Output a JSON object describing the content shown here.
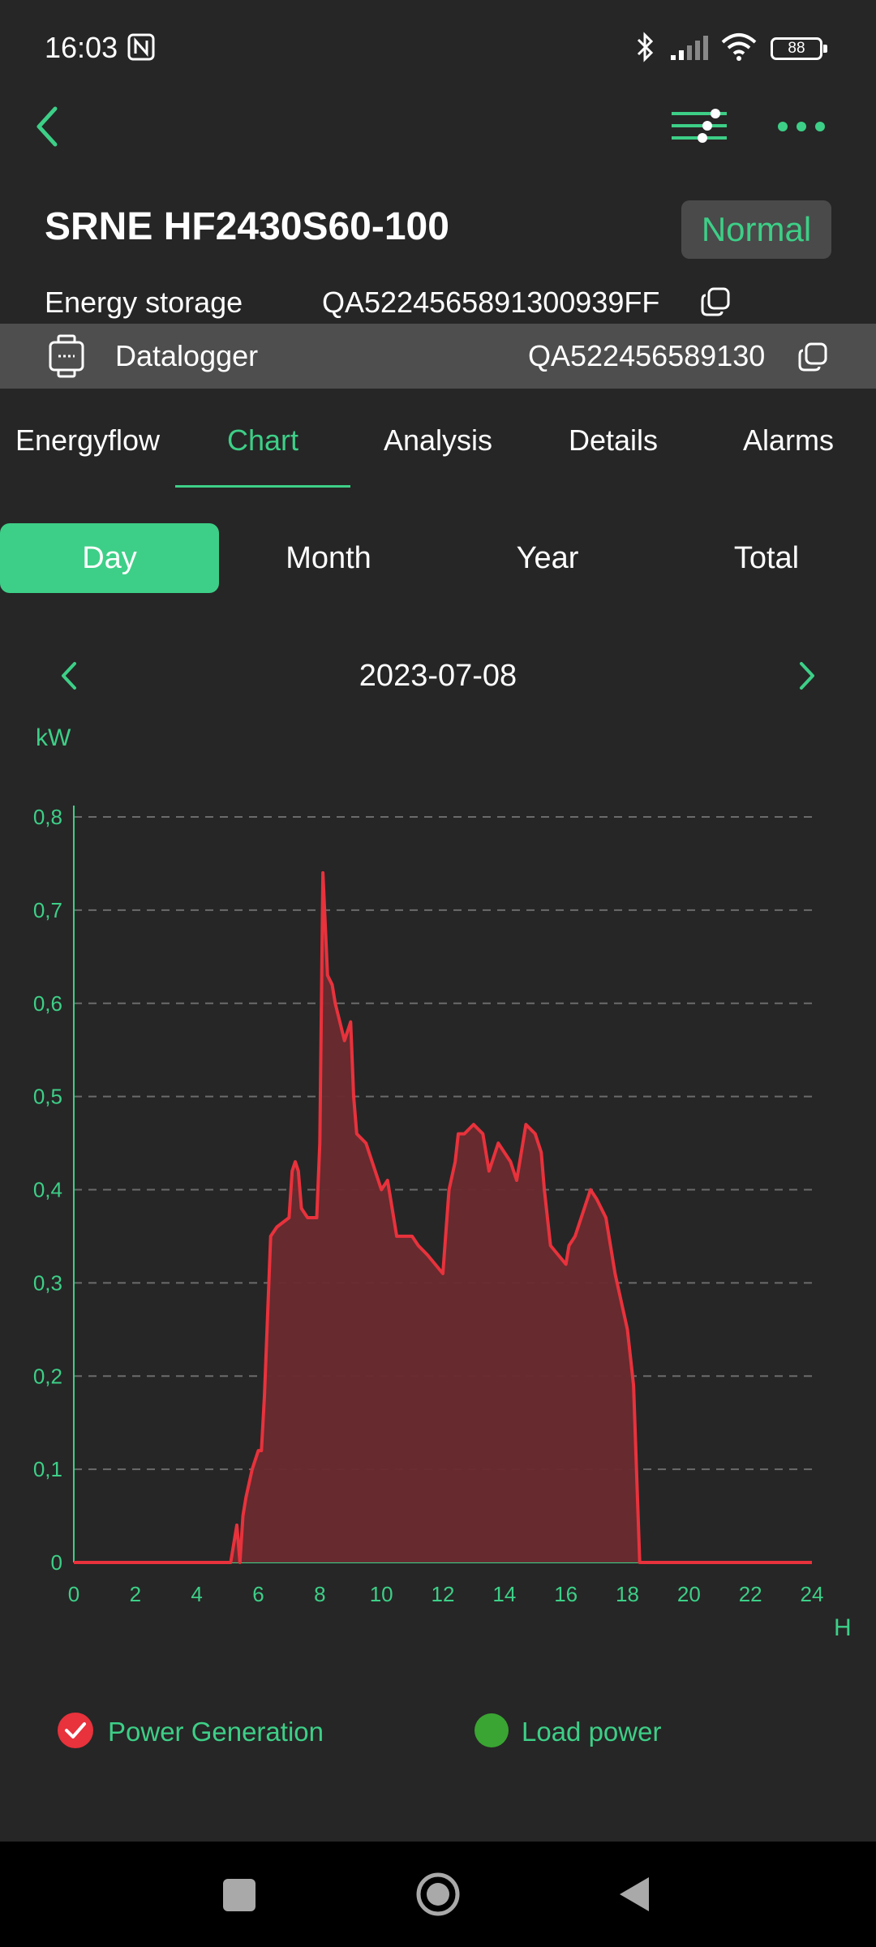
{
  "status_bar": {
    "time": "16:03",
    "battery": "88"
  },
  "header": {
    "device_title": "SRNE HF2430S60-100",
    "status": "Normal",
    "type_label": "Energy storage",
    "serial": "QA5224565891300939FF",
    "logger_label": "Datalogger",
    "logger_serial": "QA522456589130"
  },
  "tabs": [
    {
      "label": "Energyflow"
    },
    {
      "label": "Chart"
    },
    {
      "label": "Analysis"
    },
    {
      "label": "Details"
    },
    {
      "label": "Alarms"
    }
  ],
  "active_tab": "Chart",
  "periods": [
    {
      "label": "Day"
    },
    {
      "label": "Month"
    },
    {
      "label": "Year"
    },
    {
      "label": "Total"
    }
  ],
  "active_period": "Day",
  "date": "2023-07-08",
  "colors": {
    "accent": "#3dcf87",
    "series_line": "#e8323c",
    "series_fill": "#6a2a2e",
    "load": "#3aa532"
  },
  "chart_data": {
    "type": "area",
    "ylabel": "kW",
    "xlabel": "H",
    "xlim": [
      0,
      24
    ],
    "ylim": [
      0,
      0.8
    ],
    "x_ticks": [
      "0",
      "2",
      "4",
      "6",
      "8",
      "10",
      "12",
      "14",
      "16",
      "18",
      "20",
      "22",
      "24"
    ],
    "y_ticks": [
      "0",
      "0,1",
      "0,2",
      "0,3",
      "0,4",
      "0,5",
      "0,6",
      "0,7",
      "0,8"
    ],
    "grid": true,
    "legend": [
      {
        "name": "Power Generation",
        "checked": true
      },
      {
        "name": "Load power",
        "checked": false
      }
    ],
    "series": [
      {
        "name": "Power Generation",
        "x": [
          0,
          5.1,
          5.3,
          5.4,
          5.5,
          5.6,
          5.8,
          6.0,
          6.1,
          6.2,
          6.4,
          6.6,
          7.0,
          7.1,
          7.2,
          7.3,
          7.4,
          7.6,
          7.9,
          8.0,
          8.1,
          8.25,
          8.4,
          8.5,
          8.8,
          9.0,
          9.1,
          9.2,
          9.5,
          10.0,
          10.2,
          10.5,
          11.0,
          11.2,
          11.5,
          12.0,
          12.2,
          12.4,
          12.5,
          12.7,
          13.0,
          13.3,
          13.5,
          13.8,
          14.2,
          14.4,
          14.7,
          15.0,
          15.2,
          15.3,
          15.5,
          16.0,
          16.1,
          16.3,
          16.8,
          17.0,
          17.3,
          17.6,
          18.0,
          18.2,
          18.4,
          24
        ],
        "values": [
          0,
          0,
          0.04,
          0,
          0.05,
          0.07,
          0.1,
          0.12,
          0.12,
          0.18,
          0.35,
          0.36,
          0.37,
          0.42,
          0.43,
          0.42,
          0.38,
          0.37,
          0.37,
          0.45,
          0.74,
          0.63,
          0.62,
          0.6,
          0.56,
          0.58,
          0.5,
          0.46,
          0.45,
          0.4,
          0.41,
          0.35,
          0.35,
          0.34,
          0.33,
          0.31,
          0.4,
          0.43,
          0.46,
          0.46,
          0.47,
          0.46,
          0.42,
          0.45,
          0.43,
          0.41,
          0.47,
          0.46,
          0.44,
          0.4,
          0.34,
          0.32,
          0.34,
          0.35,
          0.4,
          0.39,
          0.37,
          0.31,
          0.25,
          0.19,
          0,
          0
        ]
      },
      {
        "name": "Load power",
        "x": [],
        "values": []
      }
    ]
  }
}
